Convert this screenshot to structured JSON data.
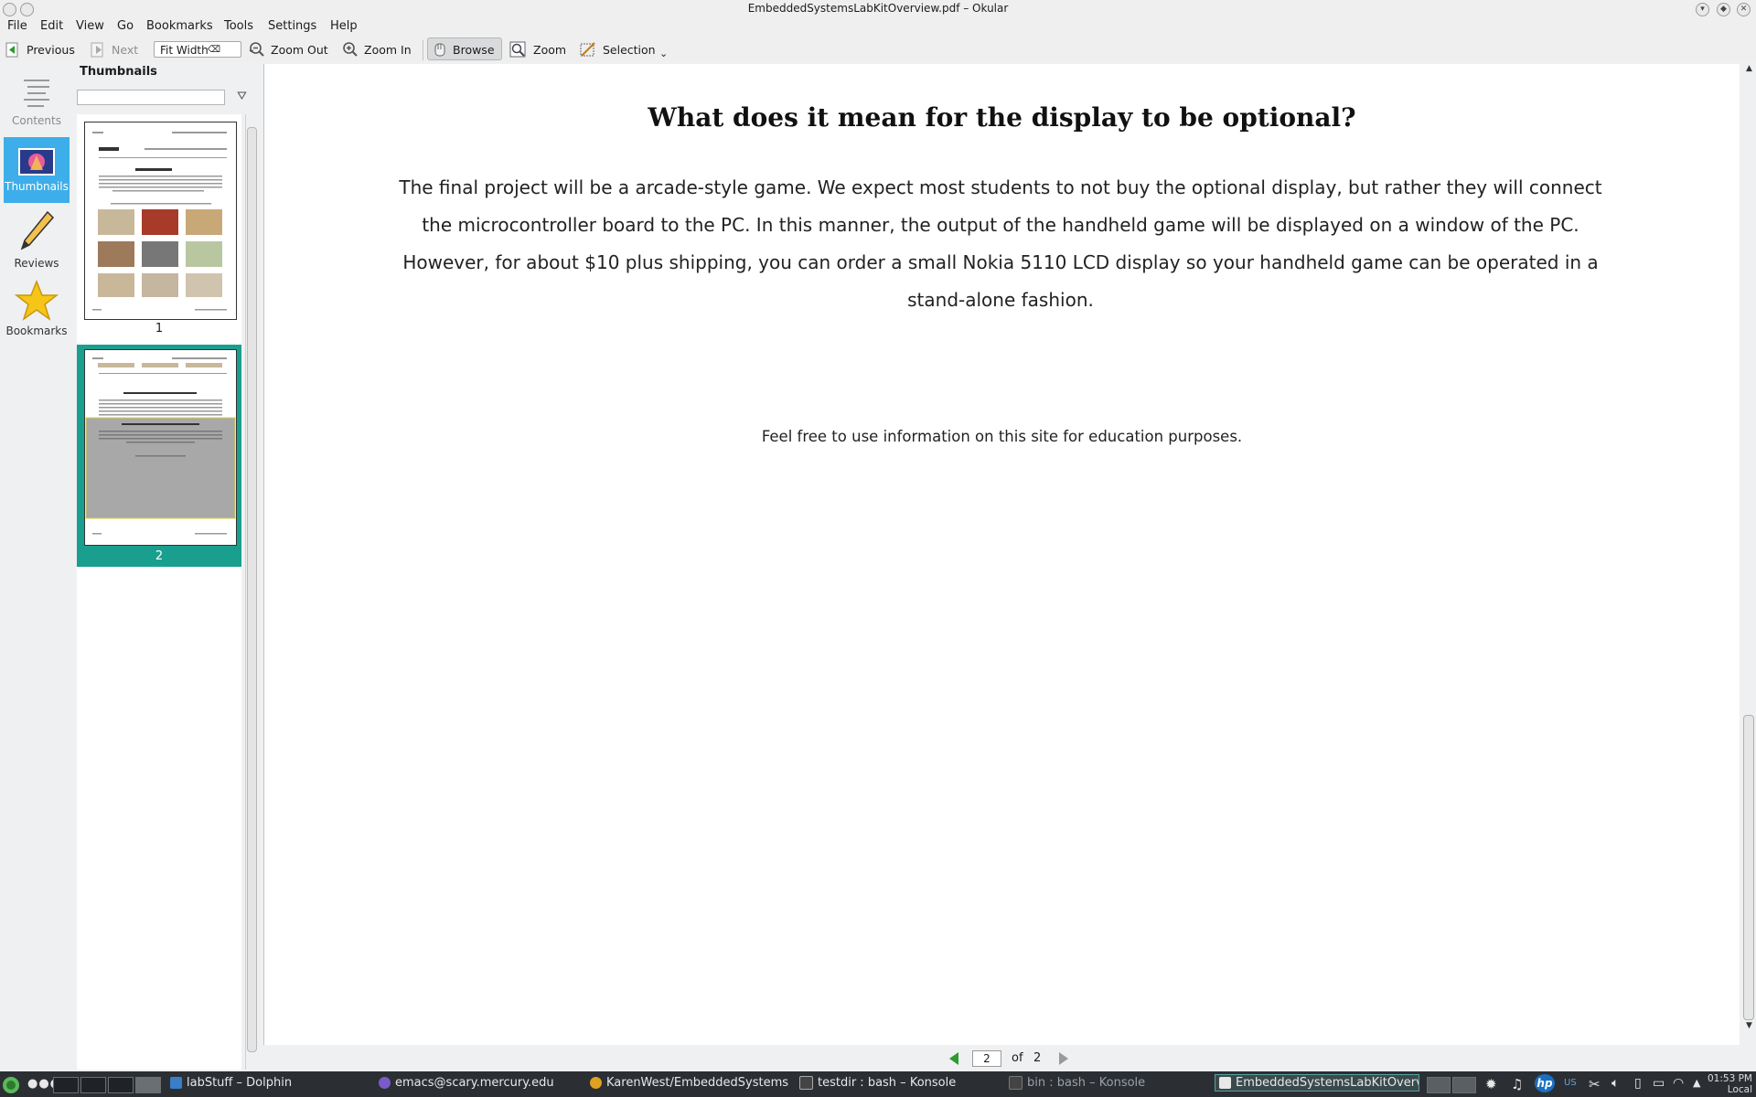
{
  "window": {
    "title": "EmbeddedSystemsLabKitOverview.pdf – Okular"
  },
  "menu": [
    "File",
    "Edit",
    "View",
    "Go",
    "Bookmarks",
    "Tools",
    "Settings",
    "Help"
  ],
  "toolbar": {
    "previous": "Previous",
    "next": "Next",
    "zoom_mode": "Fit Width",
    "zoom_out": "Zoom Out",
    "zoom_in": "Zoom In",
    "browse": "Browse",
    "zoom": "Zoom",
    "selection": "Selection"
  },
  "sidebar": {
    "contents": "Contents",
    "thumbnails": "Thumbnails",
    "reviews": "Reviews",
    "bookmarks": "Bookmarks"
  },
  "thumbnails_panel": {
    "title": "Thumbnails",
    "search_value": "",
    "pages": [
      "1",
      "2"
    ],
    "selected_page": "2"
  },
  "document": {
    "heading": "What does it mean for the display to be optional?",
    "body": "The final project will be a arcade-style game. We expect most students to not buy the optional display, but rather they will connect the microcontroller board to the PC. In this manner, the output of the handheld game will be displayed on a window of the PC. However, for about $10 plus shipping, you can order a small Nokia 5110 LCD display so your handheld game can be operated in a stand-alone fashion.",
    "footer": "Feel free to use information on this site for education purposes."
  },
  "page_nav": {
    "current": "2",
    "of_label": "of",
    "total": "2"
  },
  "taskbar": {
    "tasks": [
      "labStuff – Dolphin",
      "emacs@scary.mercury.edu",
      "KarenWest/EmbeddedSystems",
      "testdir : bash – Konsole",
      "bin : bash – Konsole",
      "EmbeddedSystemsLabKitOverv"
    ],
    "tray_keyboard": "US",
    "clock_time": "01:53 PM",
    "clock_zone": "Local"
  },
  "colors": {
    "accent": "#3daee9",
    "thumb_selected": "#1a9f8e",
    "taskbar": "#2b2f33"
  }
}
